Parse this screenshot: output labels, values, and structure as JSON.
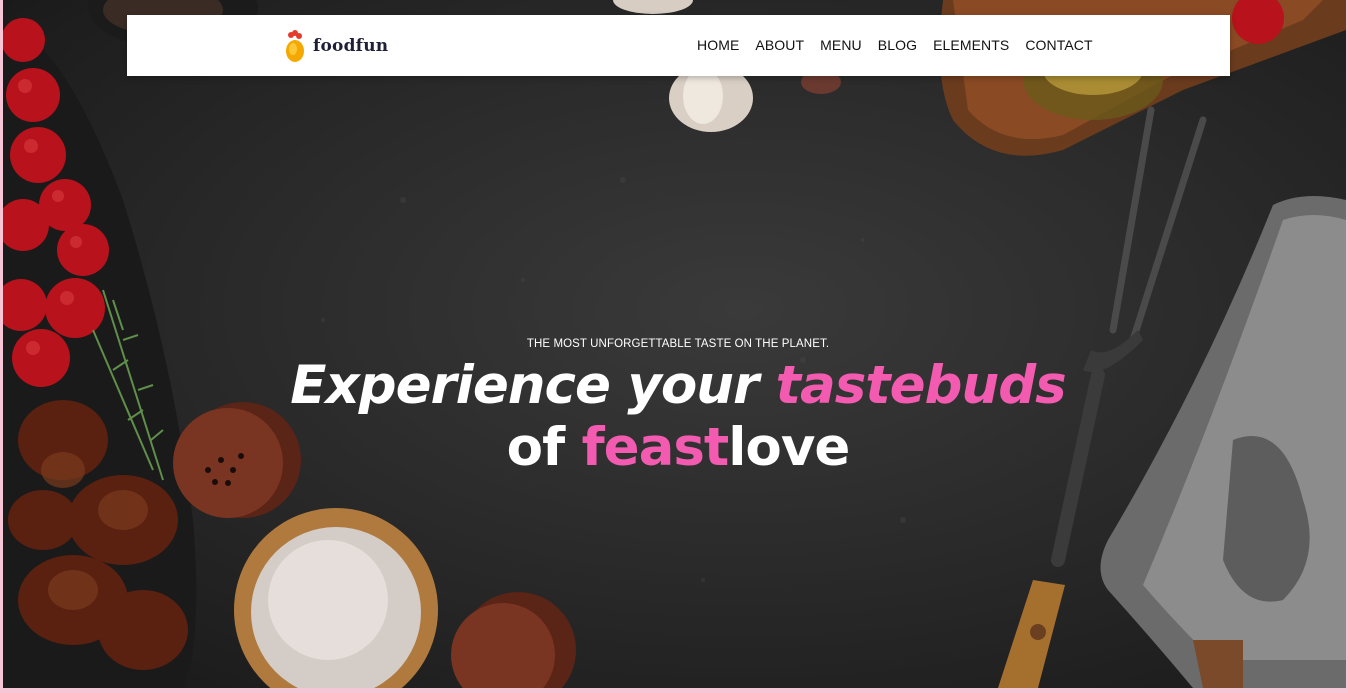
{
  "brand": {
    "name": "foodfun",
    "logo_icon": "chick-egg-icon"
  },
  "nav": {
    "items": [
      {
        "label": "HOME"
      },
      {
        "label": "ABOUT"
      },
      {
        "label": "MENU"
      },
      {
        "label": "BLOG"
      },
      {
        "label": "ELEMENTS"
      },
      {
        "label": "CONTACT"
      }
    ]
  },
  "hero": {
    "eyebrow": "THE MOST UNFORGETTABLE TASTE ON THE PLANET.",
    "line1": {
      "part1": "Experience your ",
      "accent": "tastebuds"
    },
    "line2": {
      "part1": "of ",
      "accent": "feast",
      "part2": "love"
    }
  },
  "colors": {
    "accent": "#f25bb0",
    "header_bg": "#ffffff",
    "nav_text": "#111111",
    "frame": "#f7c6d6",
    "hero_bg": "#2b2b2b"
  }
}
